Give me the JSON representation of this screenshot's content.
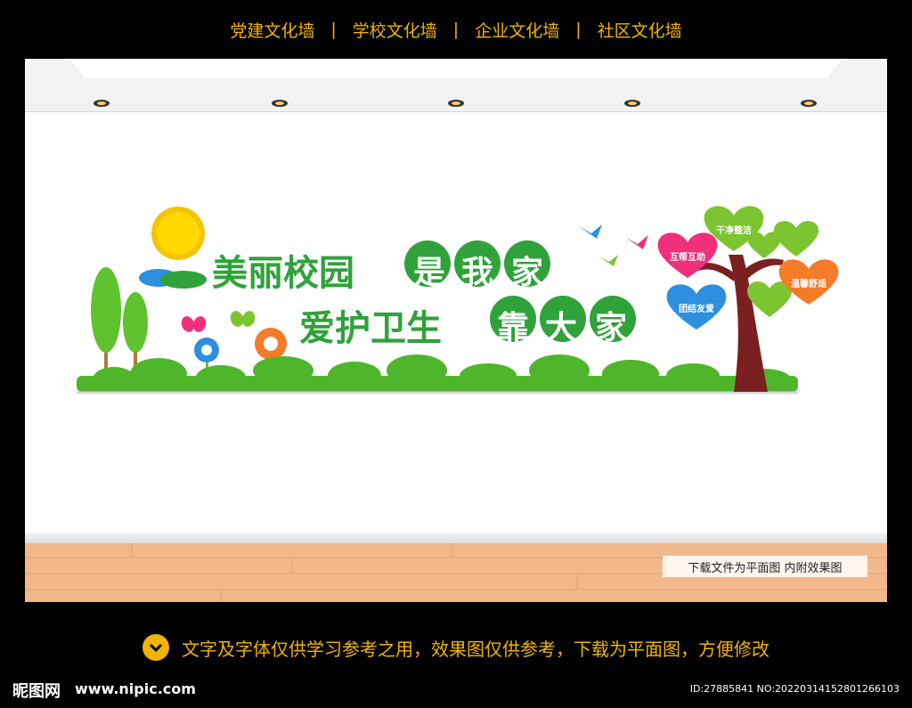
{
  "nav": {
    "items": [
      "党建文化墙",
      "学校文化墙",
      "企业文化墙",
      "社区文化墙"
    ],
    "separator": "|"
  },
  "wall": {
    "title_line1_plain": "美丽校园",
    "title_line1_circles": [
      "是",
      "我",
      "家"
    ],
    "title_line2_plain": "爱护卫生",
    "title_line2_circles": [
      "靠",
      "大",
      "家"
    ],
    "hearts": [
      "干净整洁",
      "互帮互助",
      "温馨舒适",
      "团结友爱"
    ]
  },
  "floor_note": "下载文件为平面图  内附效果图",
  "caption": "文字及字体仅供学习参考之用，效果图仅供参考，下载为平面图，方便修改",
  "footer": {
    "logo": "昵图网",
    "site": "www.nipic.com",
    "id": "ID:27885841 NO:20220314152801266103"
  },
  "colors": {
    "green": "#2fa23a",
    "light_green": "#7cc530",
    "gold": "#f0b400",
    "pink": "#f0307a",
    "blue": "#2c8fe0",
    "orange": "#f47b28",
    "trunk": "#7a2020"
  }
}
